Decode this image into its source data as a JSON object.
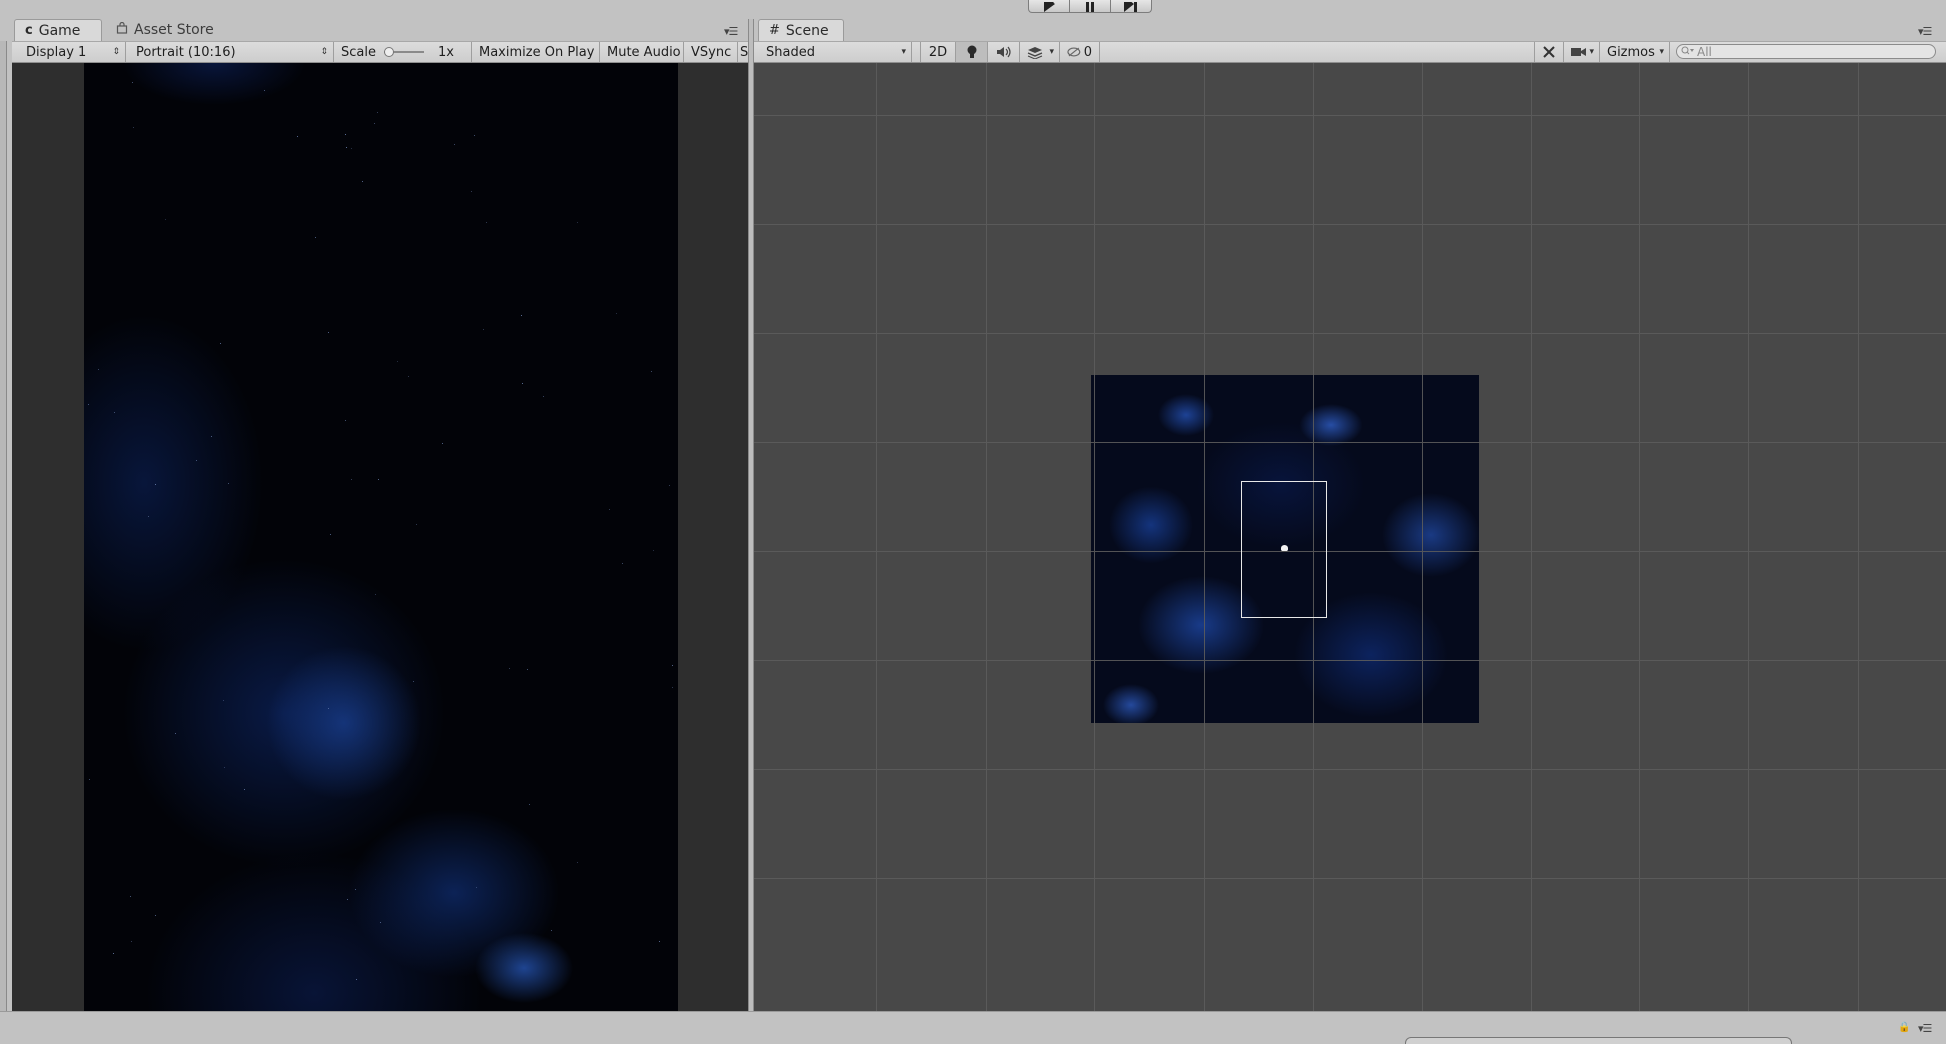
{
  "play_controls": {
    "play_icon": "play-icon",
    "pause_icon": "pause-icon",
    "step_icon": "step-icon"
  },
  "game_panel": {
    "tabs": [
      {
        "label": "Game",
        "icon": "game-controller-icon",
        "active": true
      },
      {
        "label": "Asset Store",
        "icon": "shopping-bag-icon",
        "active": false
      }
    ],
    "toolbar": {
      "display": "Display 1",
      "aspect": "Portrait (10:16)",
      "scale_label": "Scale",
      "scale_value": "1x",
      "maximize_on_play": "Maximize On Play",
      "mute_audio": "Mute Audio",
      "vsync": "VSync",
      "stats_partial": "S"
    }
  },
  "scene_panel": {
    "tabs": [
      {
        "label": "Scene",
        "icon": "grid-icon",
        "active": true
      }
    ],
    "toolbar": {
      "shading_mode": "Shaded",
      "mode_2d": "2D",
      "hidden_count": "0",
      "gizmos": "Gizmos",
      "search_placeholder": "All"
    }
  },
  "colors": {
    "editor_bg": "#c2c2c2",
    "scene_bg": "#484848",
    "scene_grid": "#5c5c5c",
    "space_blue": "#1e4fb0",
    "space_dark": "#020308"
  }
}
